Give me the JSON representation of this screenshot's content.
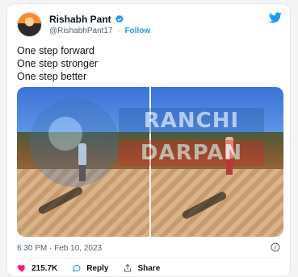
{
  "user": {
    "name": "Rishabh Pant",
    "handle": "@RishabhPant17",
    "follow": "Follow",
    "verified": true
  },
  "tweet": {
    "lines": [
      "One step forward",
      "One step stronger",
      "One step better"
    ],
    "timestamp": "6:30 PM · Feb 10, 2023"
  },
  "watermark": {
    "top_text": "RANCHI",
    "bottom_text": "DARPAN"
  },
  "actions": {
    "likes": "215.7K",
    "reply": "Reply",
    "share": "Share"
  },
  "colors": {
    "accent": "#1d9bf0",
    "like": "#f91880"
  },
  "icons": {
    "verified": "verified-badge-icon",
    "twitter": "twitter-bird-icon",
    "info": "info-icon",
    "like": "heart-icon",
    "reply": "reply-icon",
    "share": "share-icon"
  }
}
